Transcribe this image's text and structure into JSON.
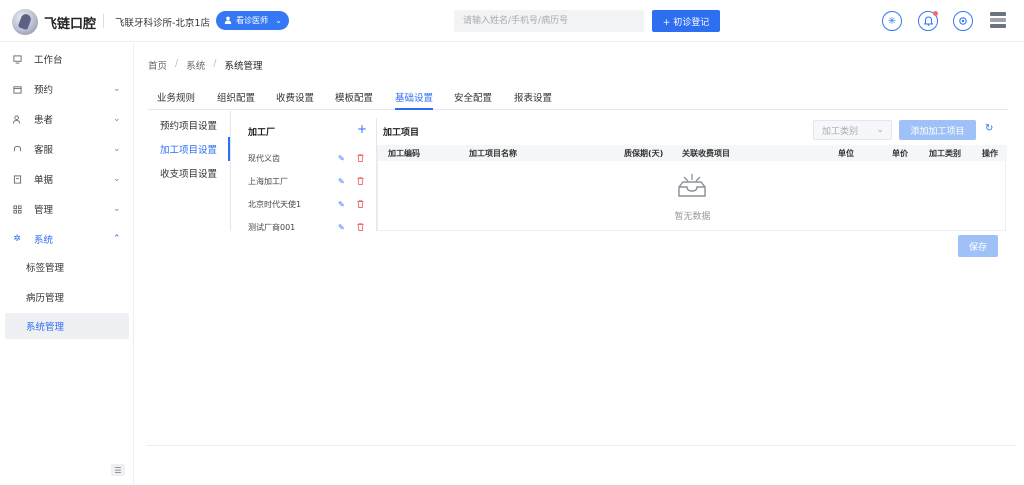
{
  "header": {
    "brand": "飞链口腔",
    "clinic": "飞联牙科诊所-北京1店",
    "doctor_button": "看诊医师",
    "search_placeholder": "请输入姓名/手机号/病历号",
    "register_button": "+ 初诊登记"
  },
  "sidebar": {
    "items": [
      {
        "label": "工作台",
        "icon": "desktop-icon"
      },
      {
        "label": "预约",
        "icon": "calendar-icon"
      },
      {
        "label": "患者",
        "icon": "users-icon"
      },
      {
        "label": "客服",
        "icon": "headset-icon"
      },
      {
        "label": "单据",
        "icon": "document-icon"
      },
      {
        "label": "管理",
        "icon": "grid-icon"
      },
      {
        "label": "系统",
        "icon": "gear-icon"
      }
    ],
    "sub_items": [
      "标签管理",
      "病历管理",
      "系统管理"
    ]
  },
  "breadcrumb": [
    "首页",
    "系统",
    "系统管理"
  ],
  "tabs": [
    "业务规则",
    "组织配置",
    "收费设置",
    "模板配置",
    "基础设置",
    "安全配置",
    "报表设置"
  ],
  "left_menu": [
    "预约项目设置",
    "加工项目设置",
    "收支项目设置"
  ],
  "factory_panel": {
    "title": "加工厂",
    "factories": [
      "现代义齿",
      "上海加工厂",
      "北京时代天使1",
      "测试厂商001"
    ]
  },
  "processing": {
    "title": "加工项目",
    "type_select_placeholder": "加工类别",
    "add_button": "添加加工项目",
    "columns": [
      "加工编码",
      "加工项目名称",
      "质保期(天)",
      "关联收费项目",
      "单位",
      "单价",
      "加工类别",
      "操作"
    ],
    "empty_text": "暂无数据"
  },
  "save_button": "保存",
  "colors": {
    "accent": "#2e6ff2",
    "danger": "#f56c6c",
    "disabled": "#a0c1f8"
  }
}
